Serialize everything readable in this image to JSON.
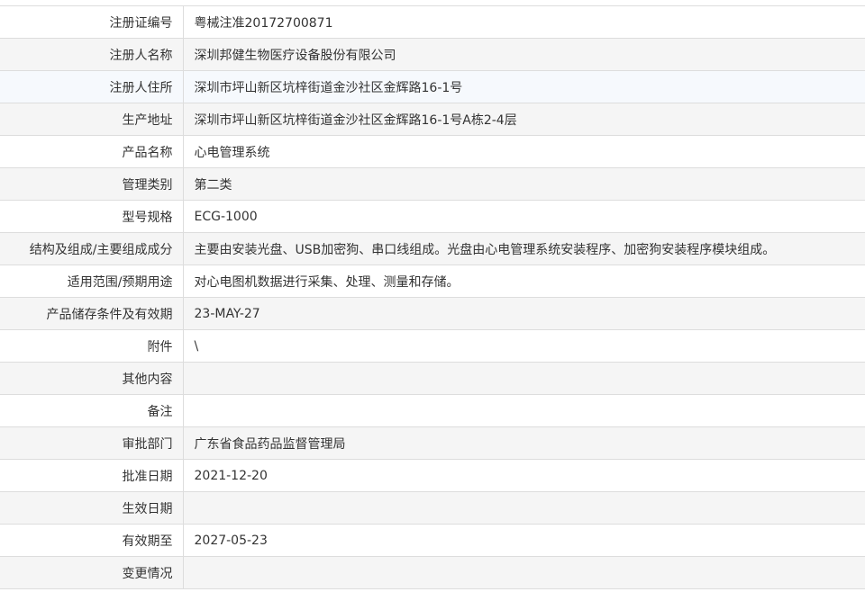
{
  "fields": [
    {
      "label": "注册证编号",
      "value": "粤械注准20172700871"
    },
    {
      "label": "注册人名称",
      "value": "深圳邦健生物医疗设备股份有限公司"
    },
    {
      "label": "注册人住所",
      "value": "深圳市坪山新区坑梓街道金沙社区金辉路16-1号"
    },
    {
      "label": "生产地址",
      "value": "深圳市坪山新区坑梓街道金沙社区金辉路16-1号A栋2-4层"
    },
    {
      "label": "产品名称",
      "value": "心电管理系统"
    },
    {
      "label": "管理类别",
      "value": "第二类"
    },
    {
      "label": "型号规格",
      "value": "ECG-1000"
    },
    {
      "label": "结构及组成/主要组成成分",
      "value": "主要由安装光盘、USB加密狗、串口线组成。光盘由心电管理系统安装程序、加密狗安装程序模块组成。"
    },
    {
      "label": "适用范围/预期用途",
      "value": "对心电图机数据进行采集、处理、测量和存储。"
    },
    {
      "label": "产品储存条件及有效期",
      "value": "23-MAY-27"
    },
    {
      "label": "附件",
      "value": "\\"
    },
    {
      "label": "其他内容",
      "value": ""
    },
    {
      "label": "备注",
      "value": ""
    },
    {
      "label": "审批部门",
      "value": "广东省食品药品监督管理局"
    },
    {
      "label": "批准日期",
      "value": "2021-12-20"
    },
    {
      "label": "生效日期",
      "value": ""
    },
    {
      "label": "有效期至",
      "value": "2027-05-23"
    },
    {
      "label": "变更情况",
      "value": ""
    }
  ],
  "colors": {
    "border": "#dddddd",
    "stripe": "#f5f5f5",
    "highlight": "#f6f9fd",
    "text": "#333333"
  }
}
